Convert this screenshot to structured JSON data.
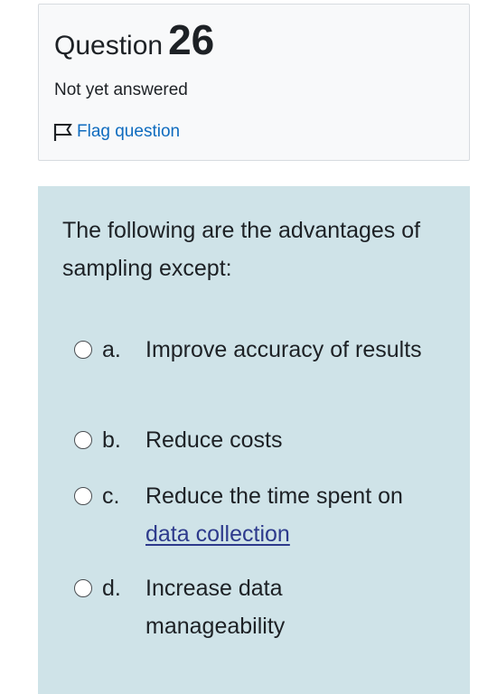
{
  "question": {
    "label": "Question",
    "number": "26",
    "state": "Not yet answered",
    "flag_label": "Flag question"
  },
  "prompt": {
    "text": "The following are the advantages of sampling except:"
  },
  "answers": [
    {
      "letter": "a.",
      "text": "Improve accuracy of results"
    },
    {
      "letter": "b.",
      "text": "Reduce costs"
    },
    {
      "letter": "c.",
      "text_before": "Reduce the time spent on ",
      "link_text": "data collection"
    },
    {
      "letter": "d.",
      "text": "Increase data manageability"
    }
  ],
  "colors": {
    "info_background": "#f8f9fa",
    "formulation_background": "#cfe3e8",
    "link": "#0f6cbf",
    "glossary_link": "#2d3a8c"
  }
}
